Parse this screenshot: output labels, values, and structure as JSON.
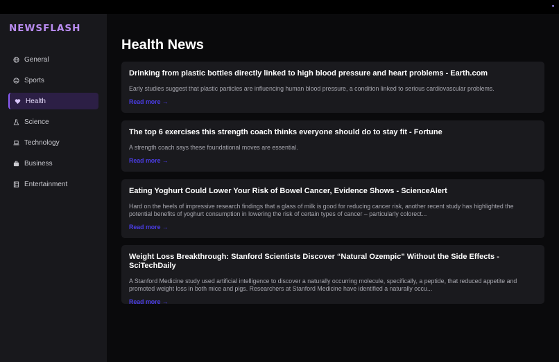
{
  "app": {
    "logo": "NEWSFLASH"
  },
  "sidebar": {
    "items": [
      {
        "label": "General",
        "icon": "globe-icon",
        "active": false
      },
      {
        "label": "Sports",
        "icon": "ball-icon",
        "active": false
      },
      {
        "label": "Health",
        "icon": "heart-icon",
        "active": true
      },
      {
        "label": "Science",
        "icon": "flask-icon",
        "active": false
      },
      {
        "label": "Technology",
        "icon": "laptop-icon",
        "active": false
      },
      {
        "label": "Business",
        "icon": "briefcase-icon",
        "active": false
      },
      {
        "label": "Entertainment",
        "icon": "film-icon",
        "active": false
      }
    ]
  },
  "main": {
    "title": "Health News",
    "articles": [
      {
        "title": "Drinking from plastic bottles directly linked to high blood pressure and heart problems - Earth.com",
        "description": "Early studies suggest that plastic particles are influencing human blood pressure, a condition linked to serious cardiovascular problems.",
        "link_label": "Read more →"
      },
      {
        "title": "The top 6 exercises this strength coach thinks everyone should do to stay fit - Fortune",
        "description": "A strength coach says these foundational moves are essential.",
        "link_label": "Read more →"
      },
      {
        "title": "Eating Yoghurt Could Lower Your Risk of Bowel Cancer, Evidence Shows - ScienceAlert",
        "description": "Hard on the heels of impressive research findings that a glass of milk is good for reducing cancer risk, another recent study has highlighted the potential benefits of yoghurt consumption in lowering the risk of certain types of cancer – particularly colorect...",
        "link_label": "Read more →"
      },
      {
        "title": "Weight Loss Breakthrough: Stanford Scientists Discover “Natural Ozempic” Without the Side Effects - SciTechDaily",
        "description": "A Stanford Medicine study used artificial intelligence to discover a naturally occurring molecule, specifically, a peptide, that reduced appetite and promoted weight loss in both mice and pigs. Researchers at Stanford Medicine have identified a naturally occu...",
        "link_label": "Read more →"
      }
    ]
  },
  "colors": {
    "accent": "#8a5cf5",
    "logo": "#b98cf0",
    "link": "#4b3de6",
    "sidebar_bg": "#18181c",
    "card_bg": "#1a1a1e"
  }
}
